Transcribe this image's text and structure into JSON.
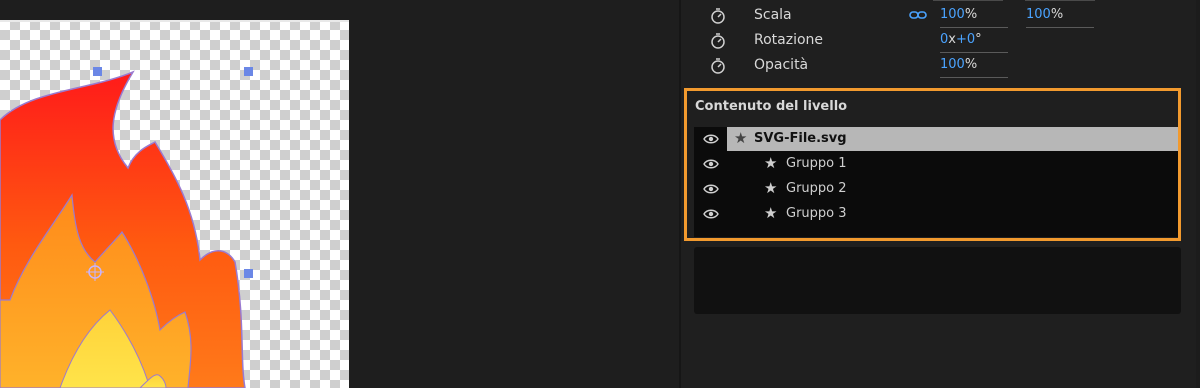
{
  "properties": {
    "rows": [
      {
        "label": "Scala",
        "value1_num": "100",
        "value1_unit": "%",
        "value2_num": "100",
        "value2_unit": "%"
      },
      {
        "label": "Rotazione",
        "value_part1": "0",
        "value_part2": "x",
        "value_part3": "+0",
        "value_part4": "°"
      },
      {
        "label": "Opacità",
        "value_num": "100",
        "value_unit": "%"
      }
    ]
  },
  "layer_content": {
    "title": "Contenuto del livello",
    "items": [
      {
        "label": "SVG-File.svg",
        "selected": true
      },
      {
        "label": "Gruppo 1",
        "selected": false
      },
      {
        "label": "Gruppo 2",
        "selected": false
      },
      {
        "label": "Gruppo 3",
        "selected": false
      }
    ]
  },
  "colors": {
    "highlight_border": "#f29a2e",
    "value_blue": "#4aa3ff",
    "selection": "#b7b7b7"
  },
  "icons": {
    "stopwatch": "stopwatch-icon",
    "link": "link-icon",
    "eye": "eye-icon",
    "star": "star-icon"
  }
}
